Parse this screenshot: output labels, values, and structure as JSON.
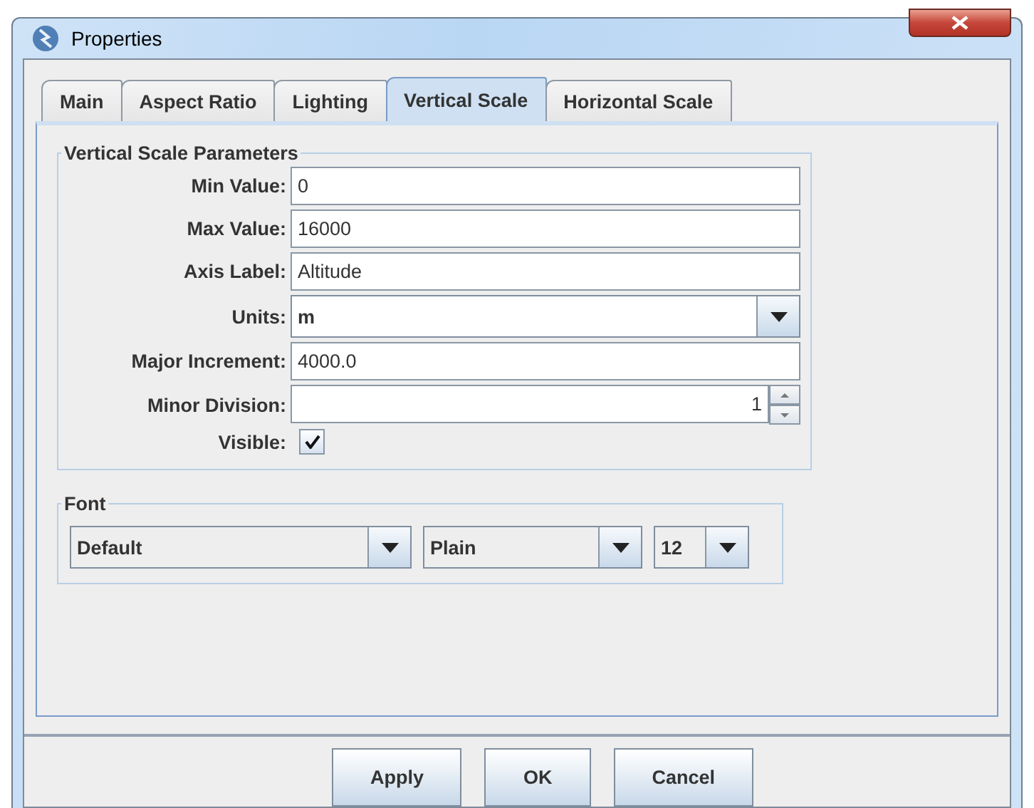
{
  "window": {
    "title": "Properties"
  },
  "tabs": [
    {
      "label": "Main",
      "selected": false
    },
    {
      "label": "Aspect Ratio",
      "selected": false
    },
    {
      "label": "Lighting",
      "selected": false
    },
    {
      "label": "Vertical Scale",
      "selected": true
    },
    {
      "label": "Horizontal Scale",
      "selected": false
    }
  ],
  "parameters": {
    "title": "Vertical Scale Parameters",
    "fields": [
      {
        "kind": "text",
        "label": "Min Value:",
        "value": "0"
      },
      {
        "kind": "text",
        "label": "Max Value:",
        "value": "16000"
      },
      {
        "kind": "text",
        "label": "Axis Label:",
        "value": "Altitude"
      },
      {
        "kind": "combo",
        "label": "Units:",
        "value": "m"
      },
      {
        "kind": "text",
        "label": "Major Increment:",
        "value": "4000.0"
      },
      {
        "kind": "spinner",
        "label": "Minor Division:",
        "value": "1"
      },
      {
        "kind": "checkbox",
        "label": "Visible:",
        "checked": true
      }
    ]
  },
  "font": {
    "title": "Font",
    "family": "Default",
    "style": "Plain",
    "size": "12"
  },
  "buttons": [
    "Apply",
    "OK",
    "Cancel"
  ]
}
